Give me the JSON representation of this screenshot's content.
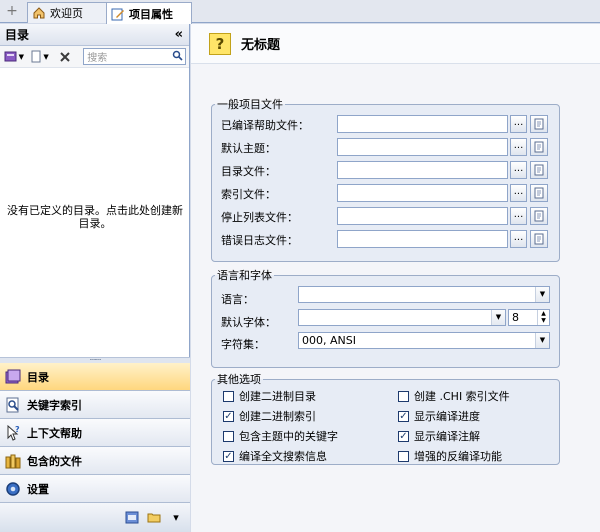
{
  "tabs": [
    {
      "label": "欢迎页",
      "icon": "home-icon"
    },
    {
      "label": "项目属性",
      "icon": "edit-icon"
    }
  ],
  "left_panel": {
    "title": "目录",
    "search_placeholder": "搜索",
    "empty_message": "没有已定义的目录。点击此处创建新目录。",
    "nav": [
      {
        "label": "目录",
        "icon": "toc-icon"
      },
      {
        "label": "关键字索引",
        "icon": "index-icon"
      },
      {
        "label": "上下文帮助",
        "icon": "context-help-icon"
      },
      {
        "label": "包含的文件",
        "icon": "files-icon"
      },
      {
        "label": "设置",
        "icon": "settings-icon"
      }
    ]
  },
  "main": {
    "title": "无标题",
    "general": {
      "legend": "一般项目文件",
      "rows": [
        {
          "label": "已编译帮助文件：",
          "value": ""
        },
        {
          "label": "默认主题：",
          "value": ""
        },
        {
          "label": "目录文件：",
          "value": ""
        },
        {
          "label": "索引文件：",
          "value": ""
        },
        {
          "label": "停止列表文件：",
          "value": ""
        },
        {
          "label": "错误日志文件：",
          "value": ""
        }
      ],
      "browse_label": "..."
    },
    "lang": {
      "legend": "语言和字体",
      "language_label": "语言：",
      "language_value": "",
      "font_label": "默认字体：",
      "font_value": "",
      "font_size": "8",
      "charset_label": "字符集：",
      "charset_value": "000, ANSI"
    },
    "other": {
      "legend": "其他选项",
      "options": [
        {
          "label": "创建二进制目录",
          "checked": false
        },
        {
          "label": "创建 .CHI 索引文件",
          "checked": false
        },
        {
          "label": "创建二进制索引",
          "checked": true
        },
        {
          "label": "显示编译进度",
          "checked": true
        },
        {
          "label": "包含主题中的关键字",
          "checked": false
        },
        {
          "label": "显示编译注解",
          "checked": true
        },
        {
          "label": "编译全文搜索信息",
          "checked": true
        },
        {
          "label": "增强的反编译功能",
          "checked": false
        }
      ]
    }
  }
}
